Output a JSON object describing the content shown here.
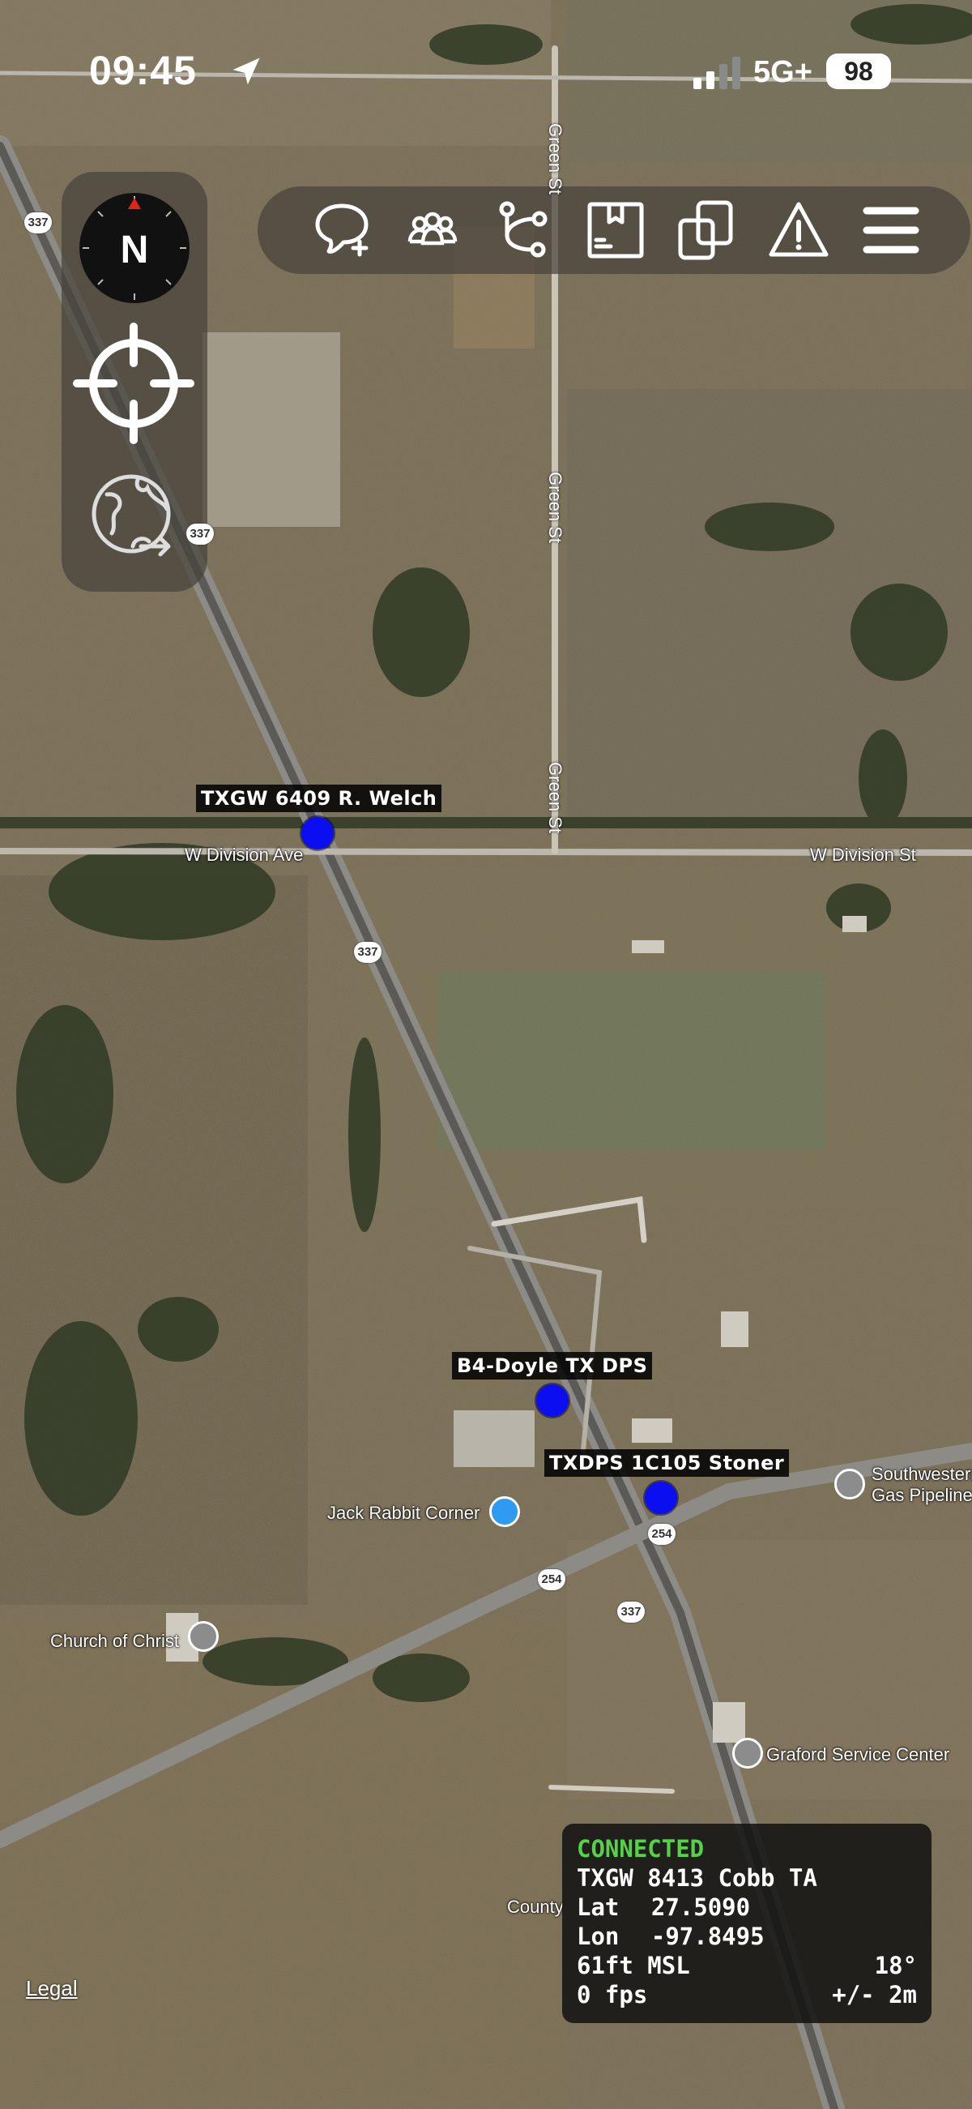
{
  "status_bar": {
    "time": "09:45",
    "network": "5G+",
    "battery": "98"
  },
  "left_controls": {
    "compass_letter": "N"
  },
  "toolbar": {
    "icons": [
      "add-chat-icon",
      "group-icon",
      "route-icon",
      "package-icon",
      "layers-icon",
      "warning-icon",
      "menu-icon"
    ]
  },
  "markers": [
    {
      "label": "TXGW 6409 R. Welch"
    },
    {
      "label": "B4-Doyle TX DPS"
    },
    {
      "label": "TXDPS 1C105 Stoner"
    }
  ],
  "map_labels": {
    "green_st_top": "Green St",
    "green_st_mid": "Green St",
    "green_st_low": "Green St",
    "w_division_ave": "W Division Ave",
    "w_division_st": "W Division St",
    "jack_rabbit_corner": "Jack Rabbit Corner",
    "church_of_christ": "Church of Christ",
    "southwestern_gas_1": "Southwestern",
    "southwestern_gas_2": "Gas Pipeline",
    "graford_service": "Graford Service Center",
    "county": "County",
    "shields": [
      "337",
      "337",
      "337",
      "254",
      "254",
      "337"
    ]
  },
  "info_panel": {
    "status": "CONNECTED",
    "name": "TXGW 8413 Cobb TA",
    "lat_label": "Lat",
    "lat_value": "27.5090",
    "lon_label": "Lon",
    "lon_value": "-97.8495",
    "altitude": "61ft MSL",
    "heading": "18°",
    "speed": "0 fps",
    "accuracy": "+/- 2m"
  },
  "legal": "Legal",
  "colors": {
    "marker": "#0b0ef0",
    "connected": "#55d24a",
    "compass_red": "#e0241b"
  }
}
